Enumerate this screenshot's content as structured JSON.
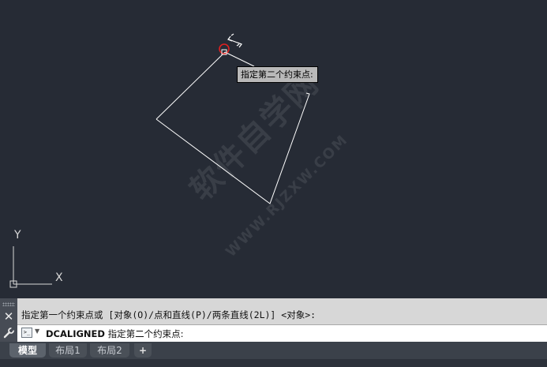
{
  "canvas": {
    "tooltip": "指定第二个约束点:",
    "watermark": "软件自学网",
    "watermark_url": "WWW.RJZXW.COM",
    "ucs_x_label": "X",
    "ucs_y_label": "Y"
  },
  "command_line": {
    "history": "指定第一个约束点或 [对象(O)/点和直线(P)/两条直线(2L)] <对象>:",
    "command_name": "DCALIGNED",
    "prompt": "指定第二个约束点:",
    "prompt_icon": ">_"
  },
  "tabs": [
    {
      "label": "模型",
      "active": true
    },
    {
      "label": "布局1",
      "active": false
    },
    {
      "label": "布局2",
      "active": false
    },
    {
      "label": "+",
      "active": false
    }
  ],
  "colors": {
    "background": "#262b35",
    "geometry": "#ffffff",
    "snap_marker": "#e02020",
    "command_bg": "#d7d7d7"
  },
  "icons": [
    "close-icon",
    "wrench-icon",
    "command-prompt-icon",
    "snap-marker-icon",
    "dimension-cursor-icon",
    "ucs-icon"
  ]
}
